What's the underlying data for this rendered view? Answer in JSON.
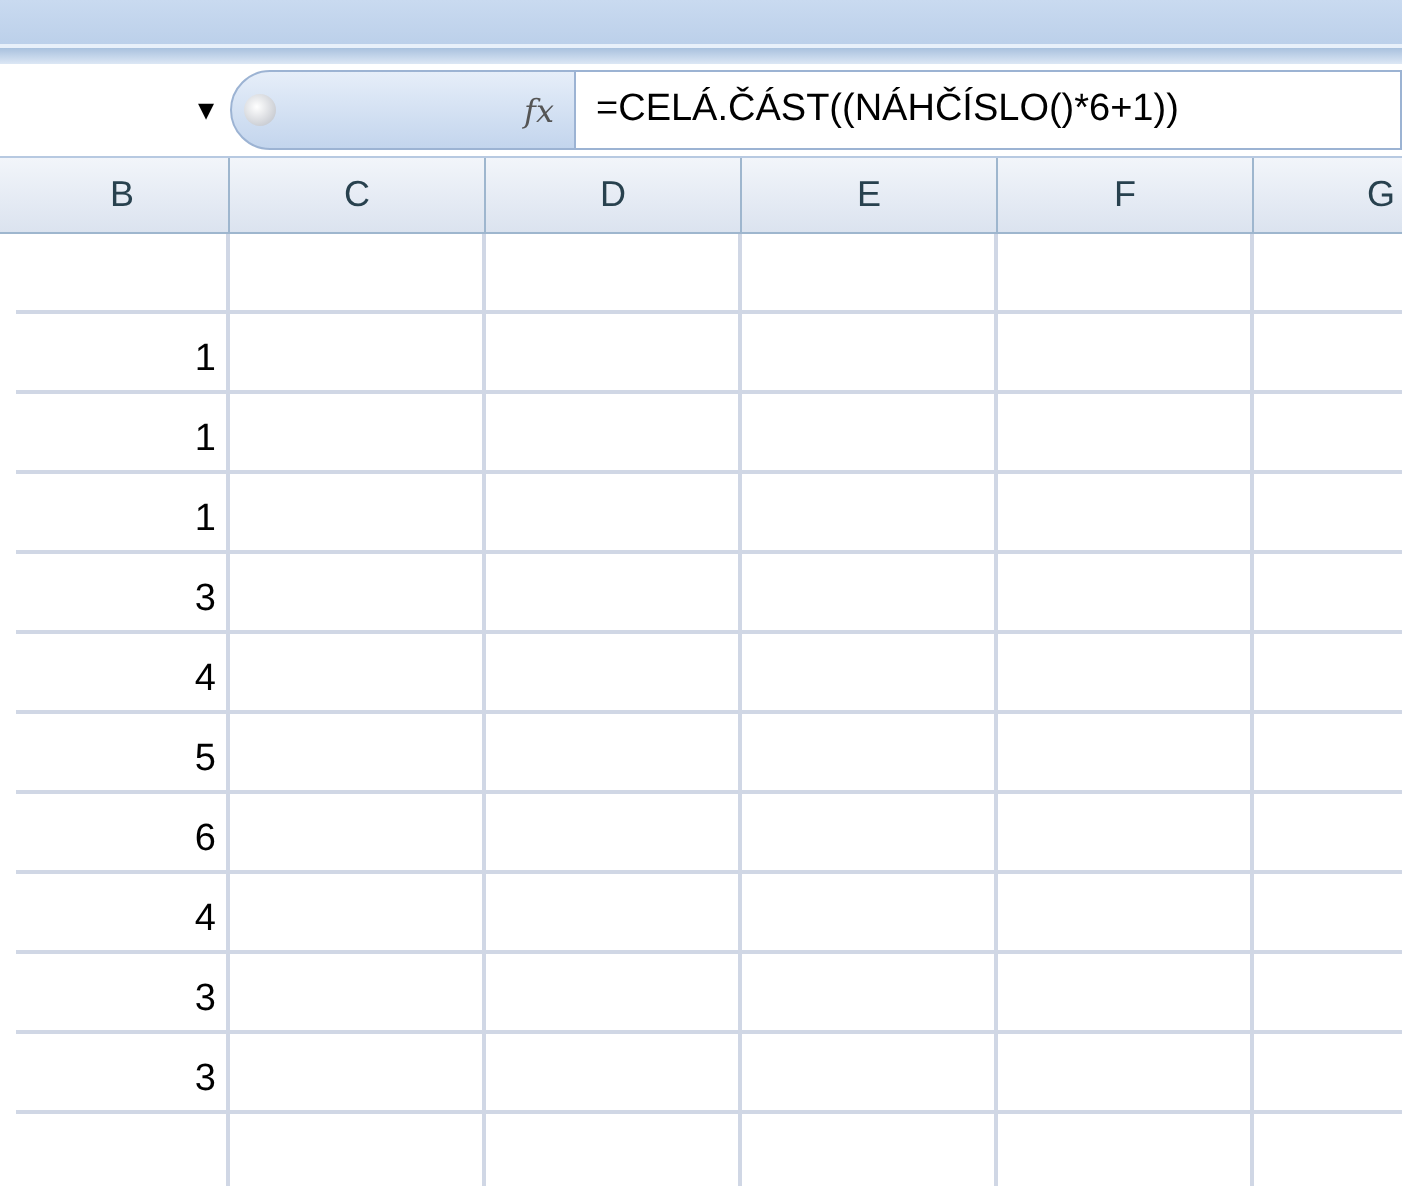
{
  "formula_bar": {
    "name_box_dropdown": "▾",
    "fx": "fx",
    "formula": "=CELÁ.ČÁST((NÁHČÍSLO()*6+1))"
  },
  "sheet": {
    "columns": [
      "B",
      "C",
      "D",
      "E",
      "F",
      "G"
    ],
    "rows": [
      {},
      {
        "b": "1"
      },
      {
        "b": "1"
      },
      {
        "b": "1"
      },
      {
        "b": "3"
      },
      {
        "b": "4"
      },
      {
        "b": "5"
      },
      {
        "b": "6"
      },
      {
        "b": "4"
      },
      {
        "b": "3"
      },
      {
        "b": "3"
      },
      {}
    ]
  }
}
